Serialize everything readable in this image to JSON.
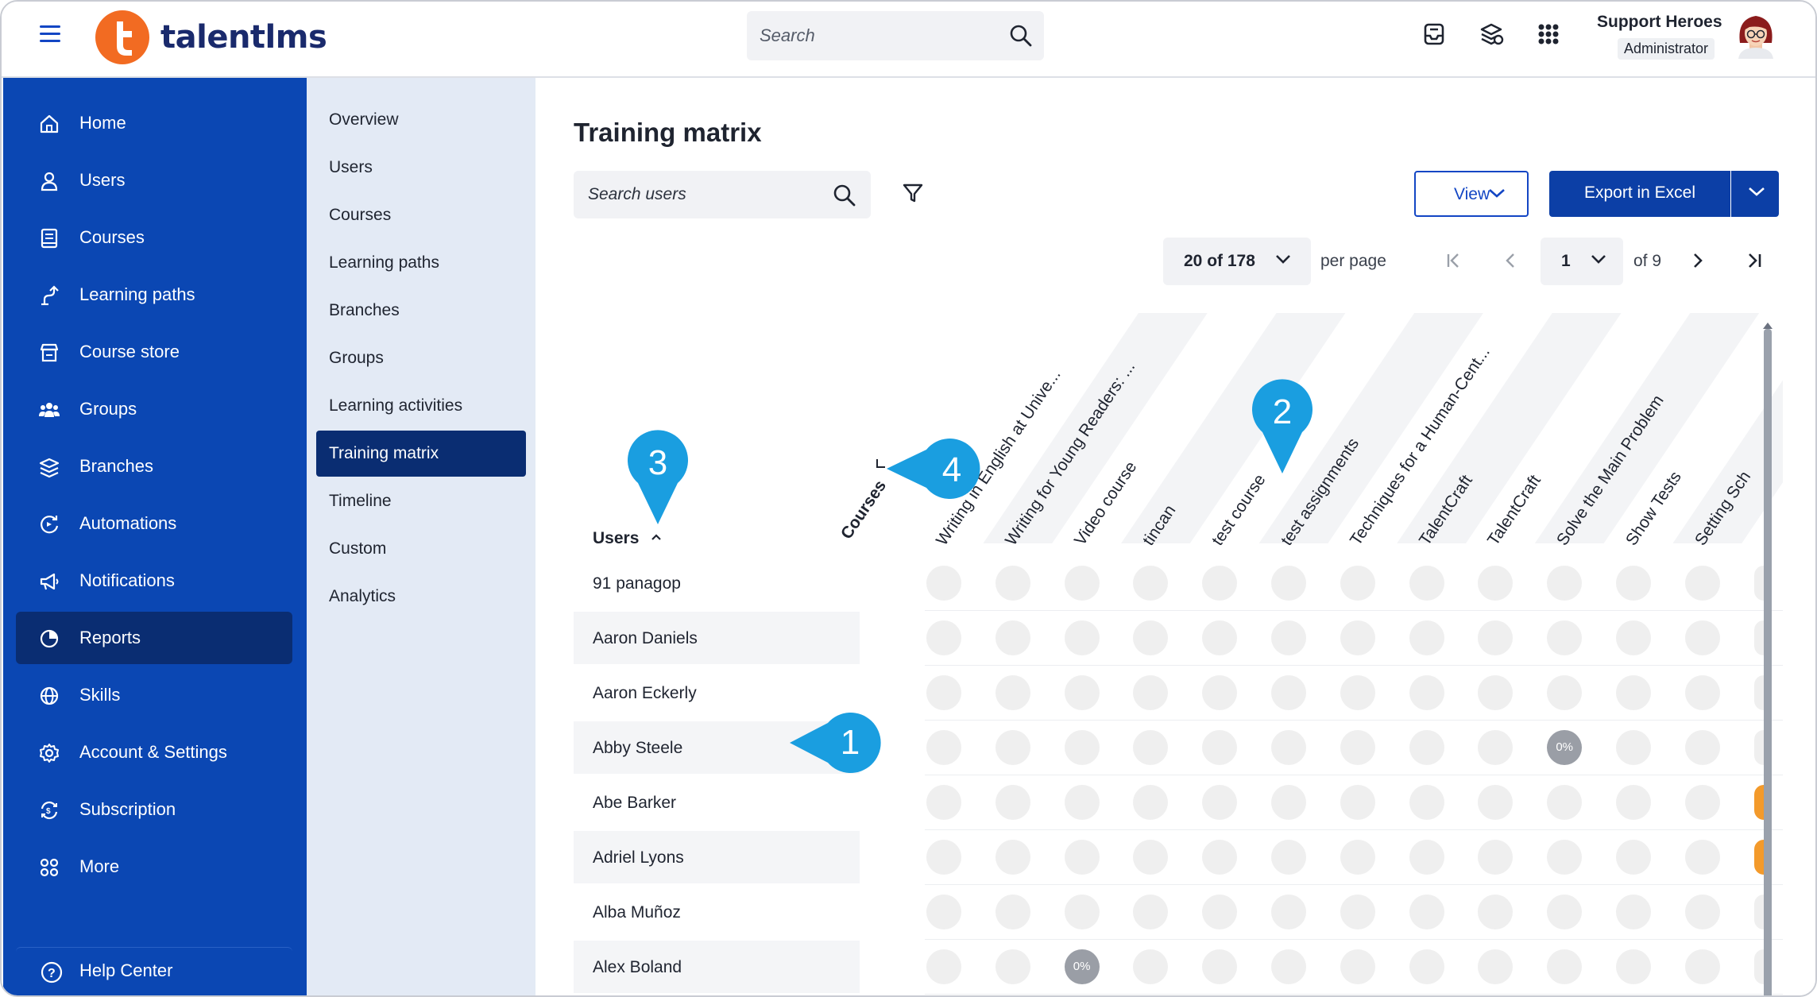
{
  "app": {
    "logo_text": "talentlms",
    "search_placeholder": "Search",
    "user_name": "Support Heroes",
    "user_role": "Administrator"
  },
  "colors": {
    "primary_nav": "#0b47b3",
    "active_nav": "#0a2d72",
    "brand_orange": "#f26b22",
    "callout": "#1a9ee0"
  },
  "sidebar": {
    "items": [
      {
        "label": "Home",
        "icon": "home-icon"
      },
      {
        "label": "Users",
        "icon": "user-icon"
      },
      {
        "label": "Courses",
        "icon": "book-icon"
      },
      {
        "label": "Learning paths",
        "icon": "path-icon"
      },
      {
        "label": "Course store",
        "icon": "store-icon"
      },
      {
        "label": "Groups",
        "icon": "groups-icon"
      },
      {
        "label": "Branches",
        "icon": "layers-icon"
      },
      {
        "label": "Automations",
        "icon": "automation-icon"
      },
      {
        "label": "Notifications",
        "icon": "megaphone-icon"
      },
      {
        "label": "Reports",
        "icon": "pie-chart-icon",
        "active": true
      },
      {
        "label": "Skills",
        "icon": "globe-icon"
      },
      {
        "label": "Account & Settings",
        "icon": "gear-icon"
      },
      {
        "label": "Subscription",
        "icon": "subscription-icon"
      },
      {
        "label": "More",
        "icon": "grid-icon"
      }
    ],
    "help_center": "Help Center"
  },
  "subnav": {
    "items": [
      {
        "label": "Overview"
      },
      {
        "label": "Users"
      },
      {
        "label": "Courses"
      },
      {
        "label": "Learning paths"
      },
      {
        "label": "Branches"
      },
      {
        "label": "Groups"
      },
      {
        "label": "Learning activities"
      },
      {
        "label": "Training matrix",
        "active": true
      },
      {
        "label": "Timeline"
      },
      {
        "label": "Custom"
      },
      {
        "label": "Analytics"
      }
    ]
  },
  "main": {
    "title": "Training matrix",
    "search_users_placeholder": "Search users",
    "view_label": "View",
    "export_label": "Export in Excel",
    "per_page_value": "20 of 178",
    "per_page_label": "per page",
    "page_value": "1",
    "of_pages": "of 9",
    "users_header": "Users",
    "courses_header": "Courses"
  },
  "courses": [
    "Writing in English at Unive...",
    "Writing for Young Readers: ...",
    "Video course",
    "tincan",
    "test course",
    "test assignments",
    "Techniques for a Human-Cent...",
    "TalentCraft",
    "TalentCraft",
    "Solve the Main Problem",
    "Show Tests",
    "Setting Sch"
  ],
  "users": [
    {
      "name": "91 panagop",
      "cells": {}
    },
    {
      "name": "Aaron Daniels",
      "cells": {}
    },
    {
      "name": "Aaron Eckerly",
      "cells": {}
    },
    {
      "name": "Abby Steele",
      "cells": {
        "9": "0%"
      }
    },
    {
      "name": "Abe Barker",
      "cells": {
        "12": "orange"
      }
    },
    {
      "name": "Adriel Lyons",
      "cells": {
        "12": "orange"
      }
    },
    {
      "name": "Alba Muñoz",
      "cells": {}
    },
    {
      "name": "Alex Boland",
      "cells": {
        "2": "0%"
      }
    }
  ],
  "callouts": [
    "1",
    "2",
    "3",
    "4"
  ]
}
